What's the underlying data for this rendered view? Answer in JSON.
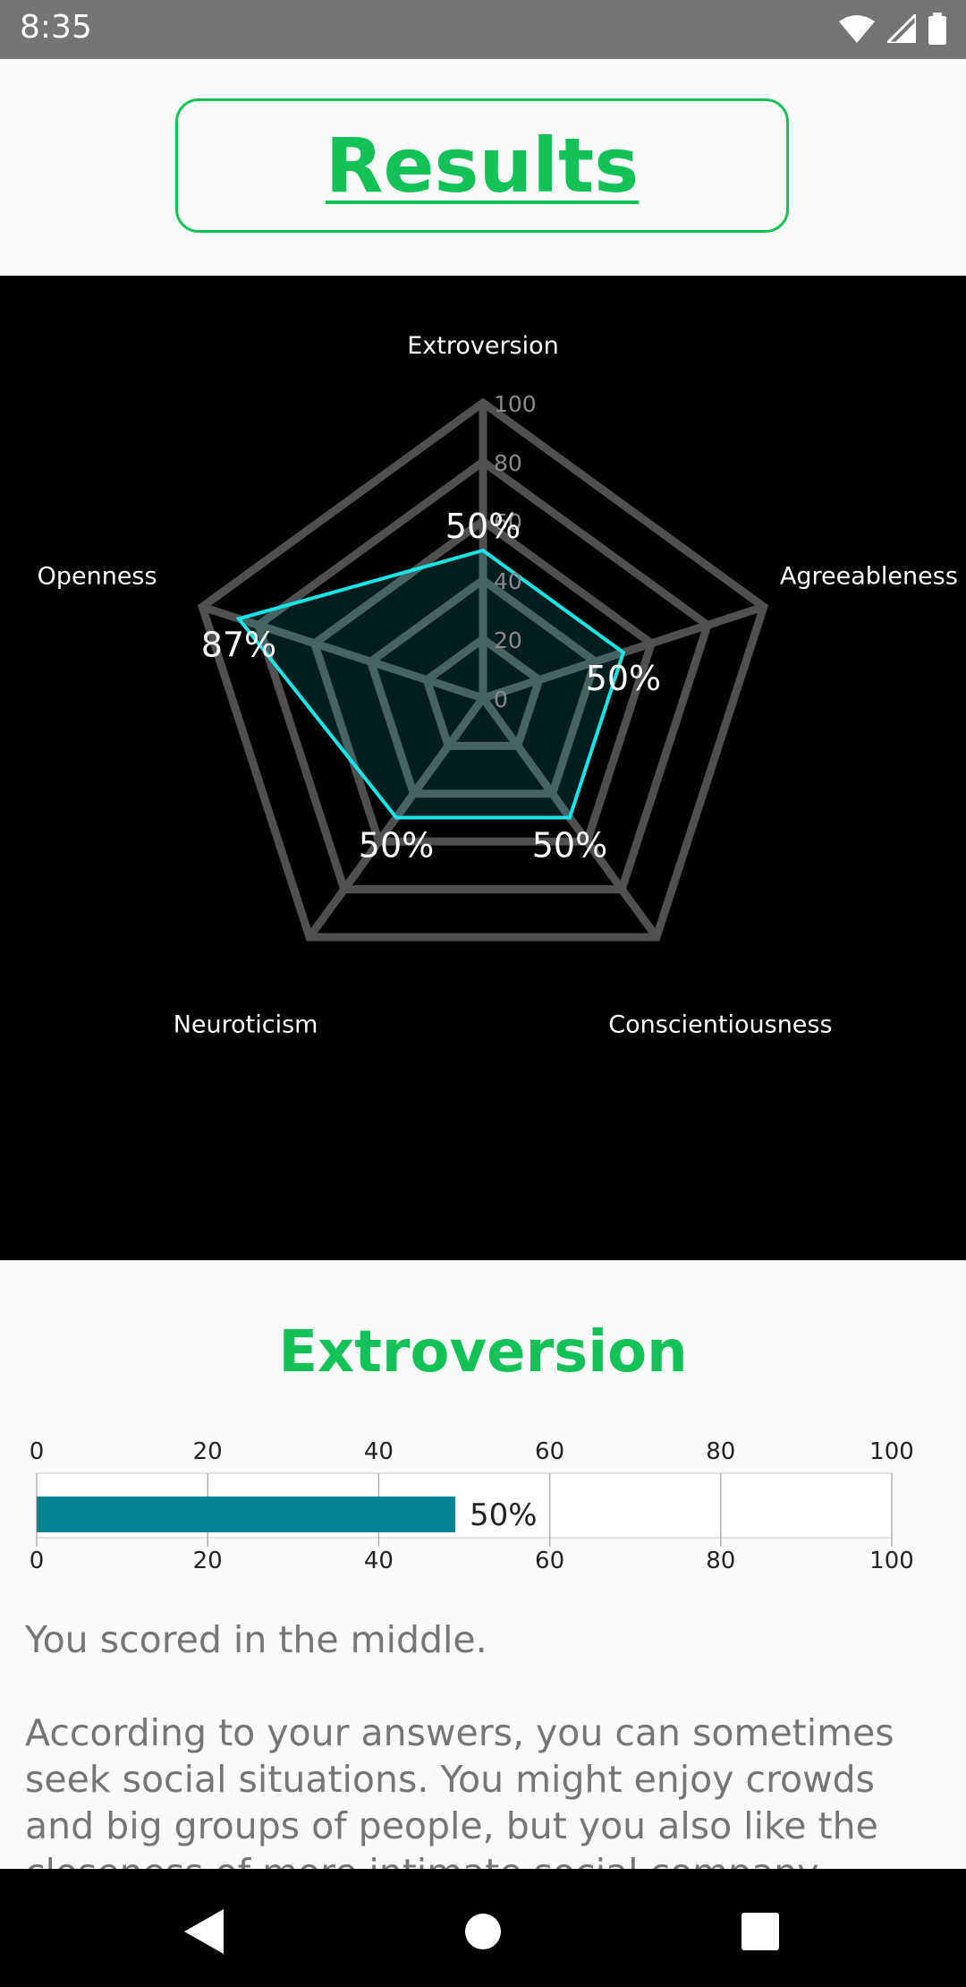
{
  "status_bar": {
    "time": "8:35"
  },
  "header": {
    "title": "Results"
  },
  "chart_data": [
    {
      "type": "radar",
      "axes": [
        "Extroversion",
        "Agreeableness",
        "Conscientiousness",
        "Neuroticism",
        "Openness"
      ],
      "values": [
        50,
        50,
        50,
        50,
        87
      ],
      "value_labels": [
        "50%",
        "50%",
        "50%",
        "50%",
        "87%"
      ],
      "scale_ticks": [
        "0",
        "20",
        "40",
        "60",
        "80",
        "100"
      ],
      "range": [
        0,
        100
      ],
      "grid": true,
      "colors": {
        "series": "#17e5e8",
        "grid": "#505050",
        "background": "#000000"
      }
    },
    {
      "type": "bar",
      "orientation": "horizontal",
      "categories": [
        "Extroversion"
      ],
      "values": [
        50
      ],
      "value_labels": [
        "50%"
      ],
      "xlim": [
        0,
        100
      ],
      "x_ticks": [
        "0",
        "20",
        "40",
        "60",
        "80",
        "100"
      ],
      "grid": true,
      "colors": {
        "bar": "#008590"
      }
    }
  ],
  "section": {
    "title": "Extroversion",
    "paragraphs": [
      "You scored in the middle.",
      "According to your answers, you can sometimes seek social situations. You might enjoy crowds and big groups of people, but you also like the closeness of more intimate social company."
    ]
  },
  "colors": {
    "accent": "#12c158",
    "status_bar": "#757575"
  },
  "nav_bar": {
    "icons": [
      "back-icon",
      "home-icon",
      "recents-icon"
    ]
  }
}
